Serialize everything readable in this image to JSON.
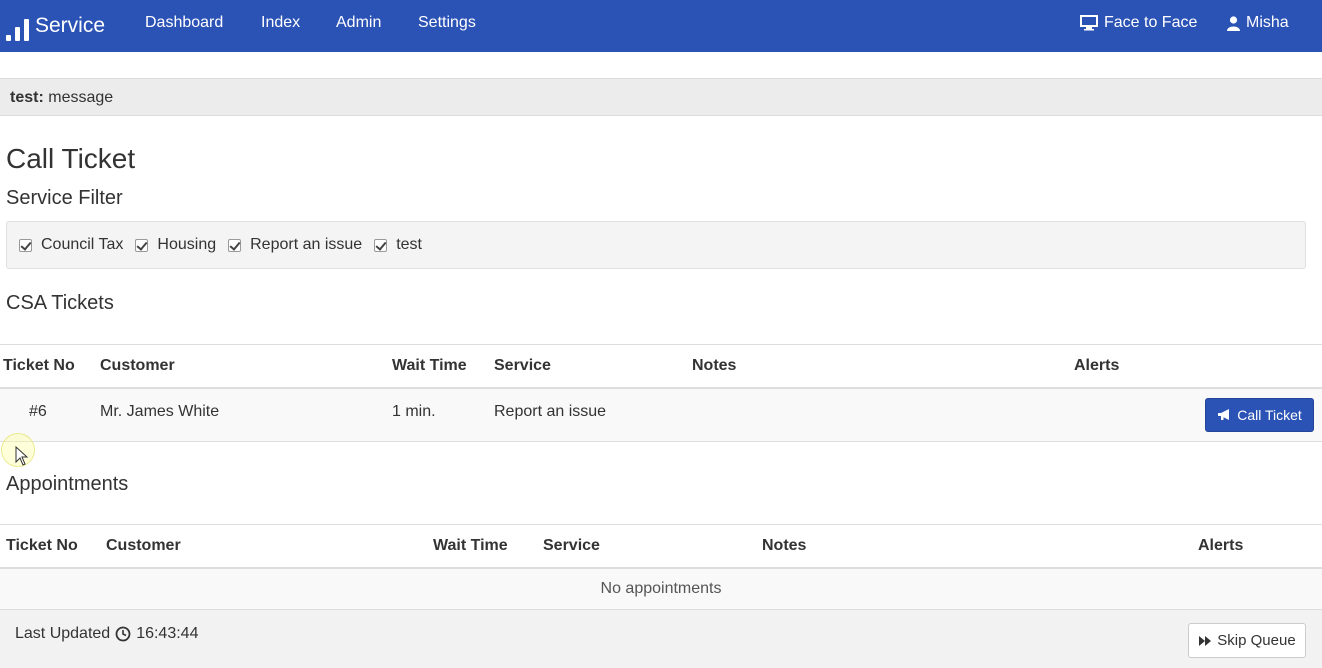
{
  "navbar": {
    "brand": "Service",
    "links": [
      "Dashboard",
      "Index",
      "Admin",
      "Settings"
    ],
    "face_to_face": "Face to Face",
    "user": "Misha"
  },
  "message": {
    "label": "test:",
    "text": "message"
  },
  "page_title": "Call Ticket",
  "service_filter": {
    "title": "Service Filter",
    "options": [
      {
        "label": "Council Tax",
        "checked": true
      },
      {
        "label": "Housing",
        "checked": true
      },
      {
        "label": "Report an issue",
        "checked": true
      },
      {
        "label": "test",
        "checked": true
      }
    ]
  },
  "csa_tickets": {
    "title": "CSA Tickets",
    "columns": [
      "Ticket No",
      "Customer",
      "Wait Time",
      "Service",
      "Notes",
      "Alerts"
    ],
    "rows": [
      {
        "ticket_no": "#6",
        "customer": "Mr. James White",
        "wait_time": "1 min.",
        "service": "Report an issue",
        "notes": "",
        "alerts": ""
      }
    ],
    "call_button": "Call Ticket"
  },
  "appointments": {
    "title": "Appointments",
    "columns": [
      "Ticket No",
      "Customer",
      "Wait Time",
      "Service",
      "Notes",
      "Alerts"
    ],
    "empty_text": "No appointments"
  },
  "footer": {
    "last_updated_label": "Last Updated",
    "time": "16:43:44",
    "skip_button": "Skip Queue"
  },
  "colors": {
    "primary": "#2b52b5"
  }
}
